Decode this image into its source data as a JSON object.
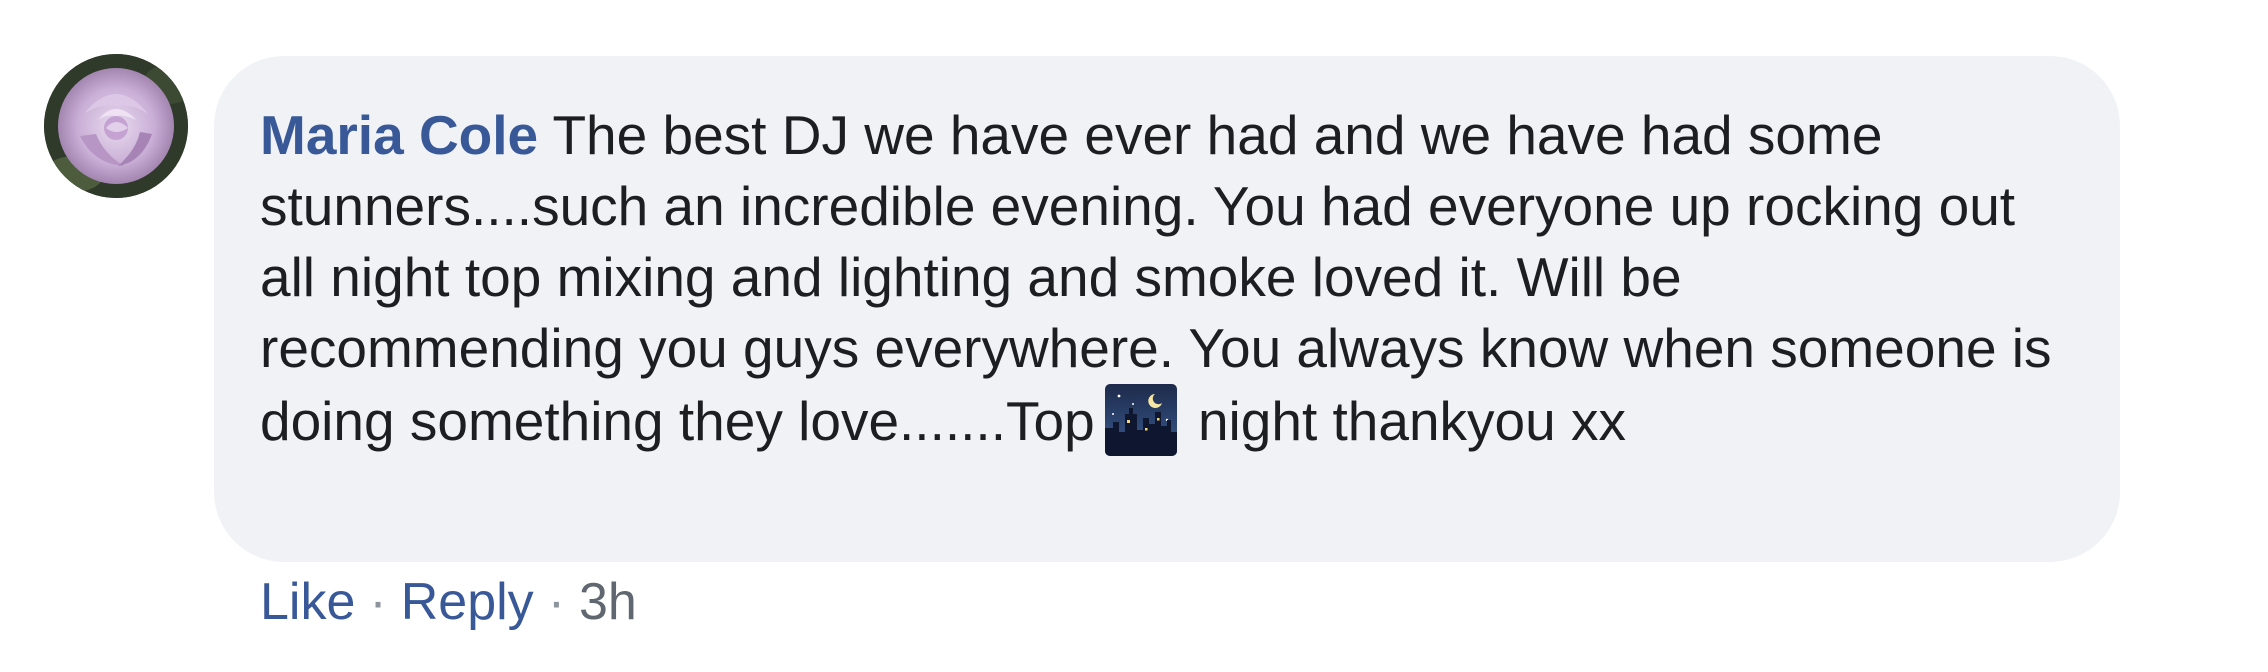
{
  "comment": {
    "author": "Maria Cole",
    "text_before_emoji": "The best DJ we have ever had and we have had some stunners....such an incredible evening. You had everyone up rocking out all night top mixing and lighting and smoke loved it. Will be recommending you guys everywhere. You always know when someone is doing something they love.......Top",
    "emoji": "night-with-stars-icon",
    "text_after_emoji": "night thankyou xx"
  },
  "actions": {
    "like_label": "Like",
    "separator": "·",
    "reply_label": "Reply",
    "timestamp": "3h"
  },
  "colors": {
    "link": "#385898",
    "bubble_bg": "#f0f2f5",
    "text": "#1c1e21",
    "meta": "#606770"
  }
}
